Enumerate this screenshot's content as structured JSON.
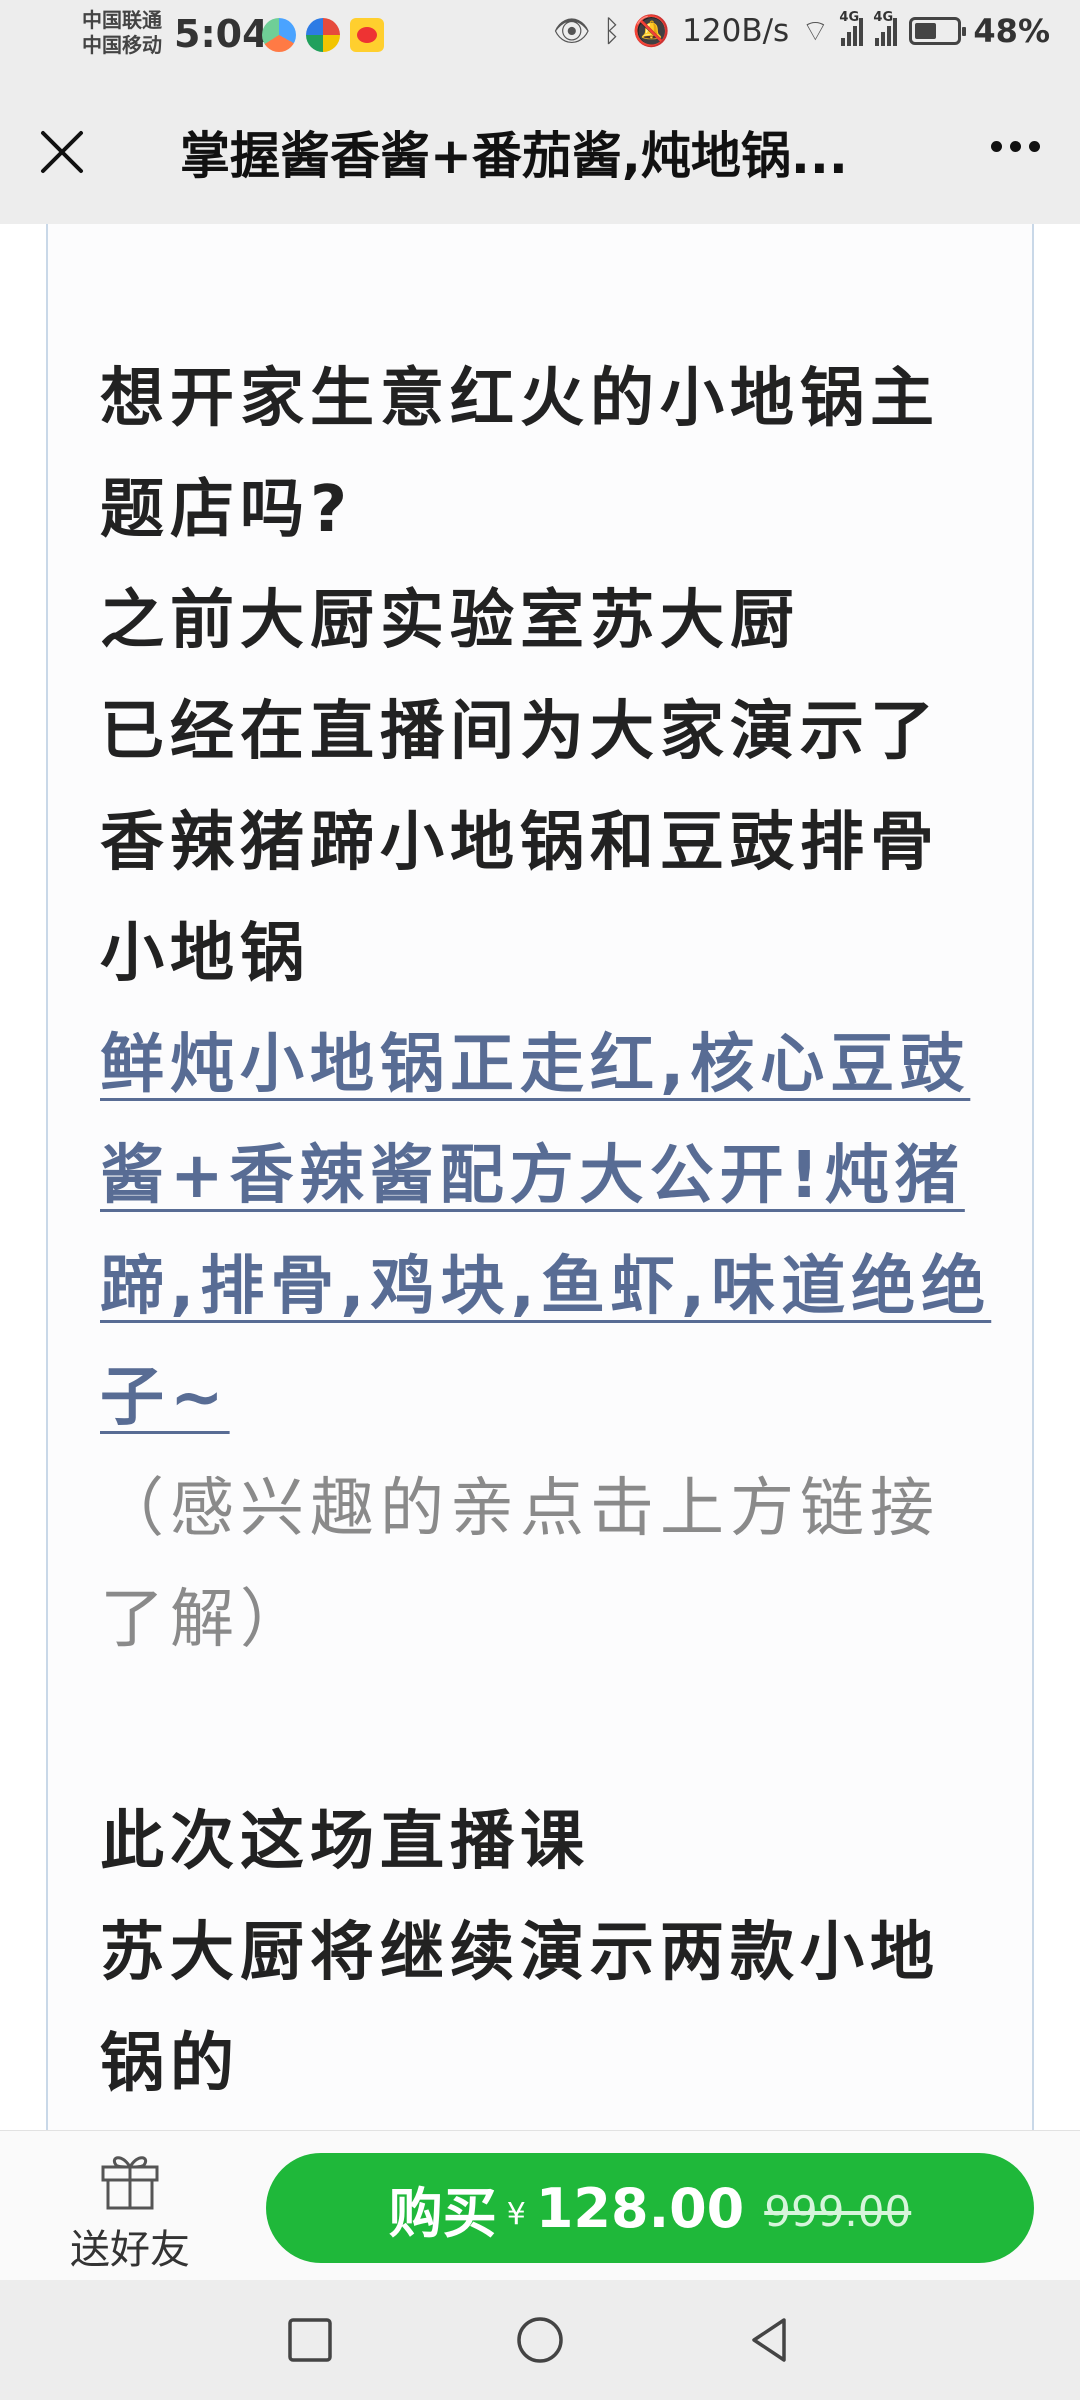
{
  "status_bar": {
    "carrier_1": "中国联通",
    "carrier_2": "中国移动",
    "time": "5:04",
    "net_speed": "120B/s",
    "network_1": "4G",
    "network_2": "4G",
    "battery": "48%"
  },
  "title_bar": {
    "title": "掌握酱香酱+番茄酱,炖地锅..."
  },
  "article": {
    "paragraphs": [
      "想开家生意红火的小地锅主题店吗?",
      "之前大厨实验室苏大厨",
      "已经在直播间为大家演示了香辣猪蹄小地锅和豆豉排骨小地锅"
    ],
    "link": "鲜炖小地锅正走红,核心豆豉酱+香辣酱配方大公开!炖猪蹄,排骨,鸡块,鱼虾,味道绝绝子~",
    "note": "（感兴趣的亲点击上方链接了解）",
    "paragraphs_2": [
      "此次这场直播课",
      "苏大厨将继续演示两款小地锅的"
    ]
  },
  "action_bar": {
    "gift_label": "送好友",
    "buy_label": "购买",
    "currency": "¥",
    "price": "128.00",
    "original_price": "999.00"
  },
  "colors": {
    "buy_button": "#1fb83a",
    "link": "#586c94",
    "note": "#8a8a8a"
  }
}
